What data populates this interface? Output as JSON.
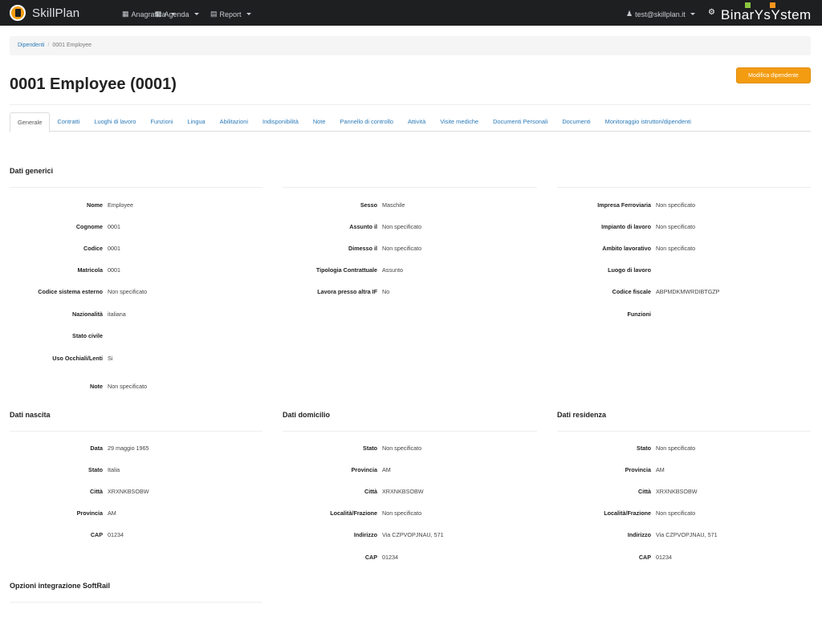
{
  "navbar": {
    "brand": "SkillPlan",
    "menus": [
      {
        "label": "Anagrafica"
      },
      {
        "label": "Agenda"
      },
      {
        "label": "Report"
      }
    ],
    "user": "test@skillplan.it",
    "company": "BinarYsYstem"
  },
  "breadcrumb": {
    "root": "Dipendenti",
    "current": "0001 Employee"
  },
  "title": "0001 Employee (0001)",
  "edit_button": "Modifica dipendente",
  "tabs": [
    "Generale",
    "Contratti",
    "Luoghi di lavoro",
    "Funzioni",
    "Lingua",
    "Abilitazioni",
    "Indisponibilità",
    "Note",
    "Pannello di controllo",
    "Attività",
    "Visite mediche",
    "Documenti Personali",
    "Documenti",
    "Monitoraggio istruttori/dipendenti"
  ],
  "sections": {
    "generic": "Dati generici",
    "birth": "Dati nascita",
    "domicile": "Dati domicilio",
    "residence": "Dati residenza",
    "softrail": "Opzioni integrazione SoftRail"
  },
  "generic_col1": [
    {
      "l": "Nome",
      "v": "Employee"
    },
    {
      "l": "Cognome",
      "v": "0001"
    },
    {
      "l": "Codice",
      "v": "0001"
    },
    {
      "l": "Matricola",
      "v": "0001"
    },
    {
      "l": "Codice sistema esterno",
      "v": "Non specificato"
    },
    {
      "l": "Nazionalità",
      "v": "italiana"
    },
    {
      "l": "Stato civile",
      "v": ""
    },
    {
      "l": "Uso Occhiali/Lenti",
      "v": "Si"
    },
    {
      "l": "Note",
      "v": "Non specificato"
    }
  ],
  "generic_col2": [
    {
      "l": "Sesso",
      "v": "Maschile"
    },
    {
      "l": "Assunto il",
      "v": "Non specificato"
    },
    {
      "l": "Dimesso il",
      "v": "Non specificato"
    },
    {
      "l": "Tipologia Contrattuale",
      "v": "Assunto"
    },
    {
      "l": "Lavora presso altra IF",
      "v": "No"
    }
  ],
  "generic_col3": [
    {
      "l": "Impresa Ferroviaria",
      "v": "Non specificato"
    },
    {
      "l": "Impianto di lavoro",
      "v": "Non specificato"
    },
    {
      "l": "Ambito lavorativo",
      "v": "Non specificato"
    },
    {
      "l": "Luogo di lavoro",
      "v": ""
    },
    {
      "l": "Codice fiscale",
      "v": "ABPMDKMWRDIBTGZP"
    },
    {
      "l": "Funzioni",
      "v": ""
    }
  ],
  "birth": [
    {
      "l": "Data",
      "v": "29 maggio 1965"
    },
    {
      "l": "Stato",
      "v": "Italia"
    },
    {
      "l": "Città",
      "v": "XRXNKBSOBW"
    },
    {
      "l": "Provincia",
      "v": "AM"
    },
    {
      "l": "CAP",
      "v": "01234"
    }
  ],
  "domicile": [
    {
      "l": "Stato",
      "v": "Non specificato"
    },
    {
      "l": "Provincia",
      "v": "AM"
    },
    {
      "l": "Città",
      "v": "XRXNKBSOBW"
    },
    {
      "l": "Località/Frazione",
      "v": "Non specificato"
    },
    {
      "l": "Indirizzo",
      "v": "Via CZPVOPJNAU, 571"
    },
    {
      "l": "CAP",
      "v": "01234"
    }
  ],
  "residence": [
    {
      "l": "Stato",
      "v": "Non specificato"
    },
    {
      "l": "Provincia",
      "v": "AM"
    },
    {
      "l": "Città",
      "v": "XRXNKBSOBW"
    },
    {
      "l": "Località/Frazione",
      "v": "Non specificato"
    },
    {
      "l": "Indirizzo",
      "v": "Via CZPVOPJNAU, 571"
    },
    {
      "l": "CAP",
      "v": "01234"
    }
  ]
}
